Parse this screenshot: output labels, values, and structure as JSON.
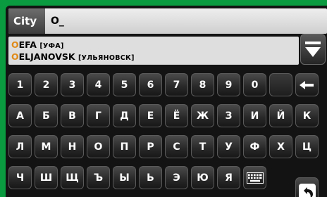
{
  "search": {
    "label": "City",
    "value": "O_"
  },
  "results": [
    {
      "highlight": "O",
      "name": "EFA",
      "native": "[УФА]"
    },
    {
      "highlight": "O",
      "name": "ELJANOVSK",
      "native": "[УЛЬЯНОВСК]"
    }
  ],
  "keyboard": {
    "rows": [
      [
        "1",
        "2",
        "3",
        "4",
        "5",
        "6",
        "7",
        "8",
        "9",
        "0",
        "",
        ""
      ],
      [
        "А",
        "Б",
        "В",
        "Г",
        "Д",
        "Е",
        "Ё",
        "Ж",
        "З",
        "И",
        "Й",
        "К"
      ],
      [
        "Л",
        "М",
        "Н",
        "О",
        "П",
        "Р",
        "С",
        "Т",
        "У",
        "Ф",
        "Х",
        "Ц"
      ],
      [
        "Ч",
        "Ш",
        "Щ",
        "Ъ",
        "Ы",
        "Ь",
        "Э",
        "Ю",
        "Я",
        "",
        ""
      ]
    ]
  },
  "icons": {
    "list_toggle": "down-arrow-list-icon",
    "backspace": "backspace-arrow-icon",
    "keyboard_switch": "keyboard-icon",
    "back": "back-arrow-icon"
  },
  "colors": {
    "frame": "#0a9a3f",
    "highlight": "#e08a18",
    "screen": "#131313"
  }
}
